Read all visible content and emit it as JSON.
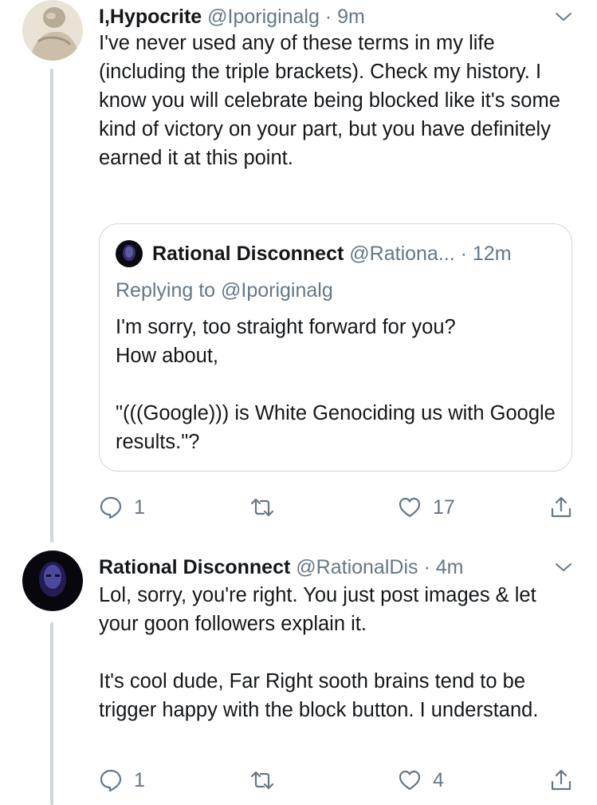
{
  "tweets": [
    {
      "name": "I,Hypocrite",
      "handle": "@Iporiginalg",
      "separator": "·",
      "time": "9m",
      "text": "I've never used any of these terms in my life (including the triple brackets). Check my history. I know you will celebrate being blocked like it's some kind of victory on your part, but you have definitely earned it at this point.",
      "avatar_icon": "statue-avatar",
      "quote": {
        "name": "Rational Disconnect",
        "handle": "@Rationa...",
        "separator": "·",
        "time": "12m",
        "replying_to": "Replying to @Iporiginalg",
        "text": "I'm sorry, too straight forward for you?\nHow about,\n\n\"(((Google))) is White Genociding us with Google results.\"?"
      },
      "actions": {
        "reply_count": "1",
        "retweet_count": "",
        "like_count": "17"
      }
    },
    {
      "name": "Rational Disconnect",
      "handle": "@RationalDis",
      "separator": "·",
      "time": "4m",
      "text": "Lol, sorry, you're right. You just post images & let your goon followers explain it.\n\nIt's cool dude, Far Right sooth brains tend to be trigger happy with the block button. I understand.",
      "avatar_icon": "dark-portrait-avatar",
      "actions": {
        "reply_count": "1",
        "retweet_count": "",
        "like_count": "4"
      }
    }
  ],
  "colors": {
    "text": "#14171a",
    "secondary": "#657786",
    "border": "#ccd6dd",
    "background": "#ffffff"
  },
  "icons": [
    "reply-icon",
    "retweet-icon",
    "like-icon",
    "share-icon",
    "chevron-down-icon"
  ]
}
